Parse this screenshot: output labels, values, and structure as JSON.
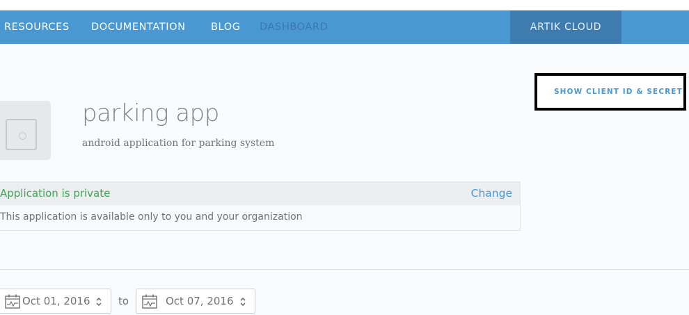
{
  "nav": {
    "items": [
      "RESOURCES",
      "DOCUMENTATION",
      "BLOG",
      "DASHBOARD"
    ],
    "cloud": "ARTIK CLOUD"
  },
  "app": {
    "title": "parking app",
    "description": "android application for parking system",
    "icon": "app-placeholder-icon"
  },
  "secret_button": "SHOW CLIENT ID & SECRET",
  "privacy": {
    "status": "Application is private",
    "change": "Change",
    "description": "This application is available only to you and your organization"
  },
  "date_range": {
    "from": "Oct 01, 2016",
    "separator": "to",
    "to": "Oct 07, 2016"
  },
  "colors": {
    "nav_bg": "#4a98d3",
    "cloud_bg": "#3e7cb0",
    "accent": "#4a98d3",
    "private_green": "#3aa753"
  }
}
